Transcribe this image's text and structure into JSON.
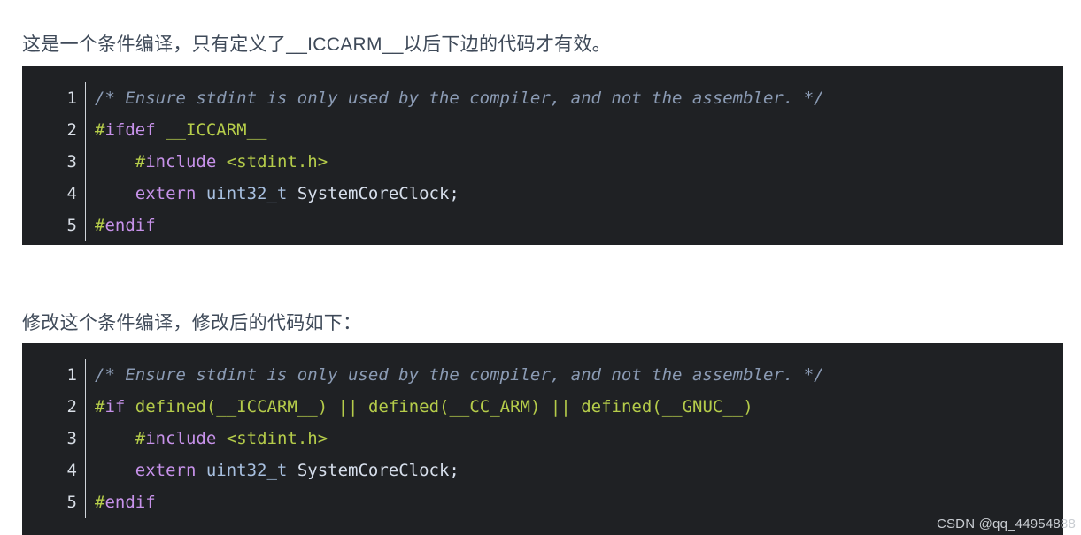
{
  "paragraphs": {
    "first": "这是一个条件编译，只有定义了__ICCARM__以后下边的代码才有效。",
    "second": "修改这个条件编译，修改后的代码如下："
  },
  "code_block_1": {
    "language": "c",
    "line_numbers": [
      "1",
      "2",
      "3",
      "4",
      "5"
    ],
    "lines": [
      {
        "number": "1",
        "text": "/* Ensure stdint is only used by the compiler, and not the assembler. */",
        "tokens": [
          {
            "t": "/* Ensure stdint is only used by the compiler, and not the assembler. */",
            "c": "tk-comment"
          }
        ]
      },
      {
        "number": "2",
        "text": "#ifdef __ICCARM__",
        "tokens": [
          {
            "t": "#",
            "c": "tk-hash"
          },
          {
            "t": "ifdef",
            "c": "tk-pre"
          },
          {
            "t": " ",
            "c": "tk-punc"
          },
          {
            "t": "__ICCARM__",
            "c": "tk-macro"
          }
        ]
      },
      {
        "number": "3",
        "text": "    #include <stdint.h>",
        "tokens": [
          {
            "t": "    ",
            "c": "tk-punc"
          },
          {
            "t": "#",
            "c": "tk-hash"
          },
          {
            "t": "include",
            "c": "tk-pre"
          },
          {
            "t": " ",
            "c": "tk-punc"
          },
          {
            "t": "<stdint.h>",
            "c": "tk-string"
          }
        ]
      },
      {
        "number": "4",
        "text": "    extern uint32_t SystemCoreClock;",
        "tokens": [
          {
            "t": "    ",
            "c": "tk-punc"
          },
          {
            "t": "extern",
            "c": "tk-kw"
          },
          {
            "t": " ",
            "c": "tk-punc"
          },
          {
            "t": "uint32_t",
            "c": "tk-type"
          },
          {
            "t": " ",
            "c": "tk-punc"
          },
          {
            "t": "SystemCoreClock",
            "c": "tk-ident"
          },
          {
            "t": ";",
            "c": "tk-punc"
          }
        ]
      },
      {
        "number": "5",
        "text": "#endif",
        "tokens": [
          {
            "t": "#",
            "c": "tk-hash"
          },
          {
            "t": "endif",
            "c": "tk-pre"
          }
        ]
      }
    ]
  },
  "code_block_2": {
    "language": "c",
    "line_numbers": [
      "1",
      "2",
      "3",
      "4",
      "5"
    ],
    "lines": [
      {
        "number": "1",
        "text": "/* Ensure stdint is only used by the compiler, and not the assembler. */",
        "tokens": [
          {
            "t": "/* Ensure stdint is only used by the compiler, and not the assembler. */",
            "c": "tk-comment"
          }
        ]
      },
      {
        "number": "2",
        "text": "#if defined(__ICCARM__) || defined(__CC_ARM) || defined(__GNUC__)",
        "tokens": [
          {
            "t": "#",
            "c": "tk-hash"
          },
          {
            "t": "if",
            "c": "tk-pre"
          },
          {
            "t": " ",
            "c": "tk-punc"
          },
          {
            "t": "defined(__ICCARM__)",
            "c": "tk-macro"
          },
          {
            "t": " ",
            "c": "tk-punc"
          },
          {
            "t": "||",
            "c": "tk-op"
          },
          {
            "t": " ",
            "c": "tk-punc"
          },
          {
            "t": "defined(__CC_ARM)",
            "c": "tk-macro"
          },
          {
            "t": " ",
            "c": "tk-punc"
          },
          {
            "t": "||",
            "c": "tk-op"
          },
          {
            "t": " ",
            "c": "tk-punc"
          },
          {
            "t": "defined(__GNUC__)",
            "c": "tk-macro"
          }
        ]
      },
      {
        "number": "3",
        "text": "    #include <stdint.h>",
        "tokens": [
          {
            "t": "    ",
            "c": "tk-punc"
          },
          {
            "t": "#",
            "c": "tk-hash"
          },
          {
            "t": "include",
            "c": "tk-pre"
          },
          {
            "t": " ",
            "c": "tk-punc"
          },
          {
            "t": "<stdint.h>",
            "c": "tk-string"
          }
        ]
      },
      {
        "number": "4",
        "text": "    extern uint32_t SystemCoreClock;",
        "tokens": [
          {
            "t": "    ",
            "c": "tk-punc"
          },
          {
            "t": "extern",
            "c": "tk-kw"
          },
          {
            "t": " ",
            "c": "tk-punc"
          },
          {
            "t": "uint32_t",
            "c": "tk-type"
          },
          {
            "t": " ",
            "c": "tk-punc"
          },
          {
            "t": "SystemCoreClock",
            "c": "tk-ident"
          },
          {
            "t": ";",
            "c": "tk-punc"
          }
        ]
      },
      {
        "number": "5",
        "text": "#endif",
        "tokens": [
          {
            "t": "#",
            "c": "tk-hash"
          },
          {
            "t": "endif",
            "c": "tk-pre"
          }
        ]
      }
    ]
  },
  "watermark": {
    "text": "CSDN @qq_44954888"
  },
  "colors": {
    "page_background": "#ffffff",
    "code_background": "#1f2124",
    "body_text": "#3f4a59",
    "line_number": "#d8dee6",
    "gutter_rule": "#cfd4da",
    "comment": "#8b9bb4",
    "preprocessor_hash": "#b5cc4a",
    "preprocessor_keyword": "#c792ea",
    "macro": "#b5cc4a",
    "type": "#a8c0e0",
    "identifier": "#d6deeb",
    "watermark": "#c9cdd2"
  }
}
